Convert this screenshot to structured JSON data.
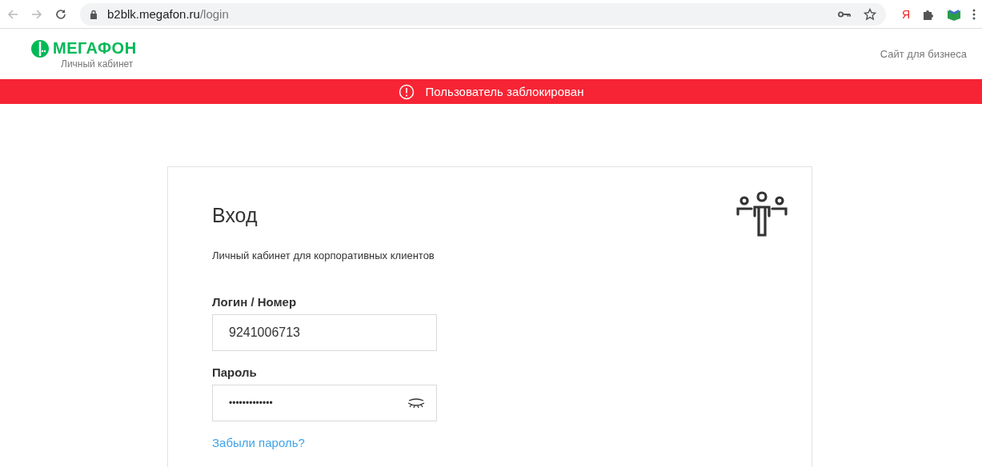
{
  "browser": {
    "url_host": "b2blk.megafon.ru",
    "url_path": "/login",
    "yandex_label": "Я"
  },
  "header": {
    "logo_text": "МЕГАФОН",
    "logo_subtitle": "Личный кабинет",
    "business_link": "Сайт для бизнеса"
  },
  "alert": {
    "text": "Пользователь заблокирован"
  },
  "login": {
    "title": "Вход",
    "subtitle": "Личный кабинет для корпоративных клиентов",
    "fields": [
      {
        "kind": "text",
        "label": "Логин / Номер",
        "value": "9241006713"
      },
      {
        "kind": "password",
        "label": "Пароль",
        "value": "•••••••••••••"
      }
    ],
    "forgot_link": "Забыли пароль?"
  }
}
